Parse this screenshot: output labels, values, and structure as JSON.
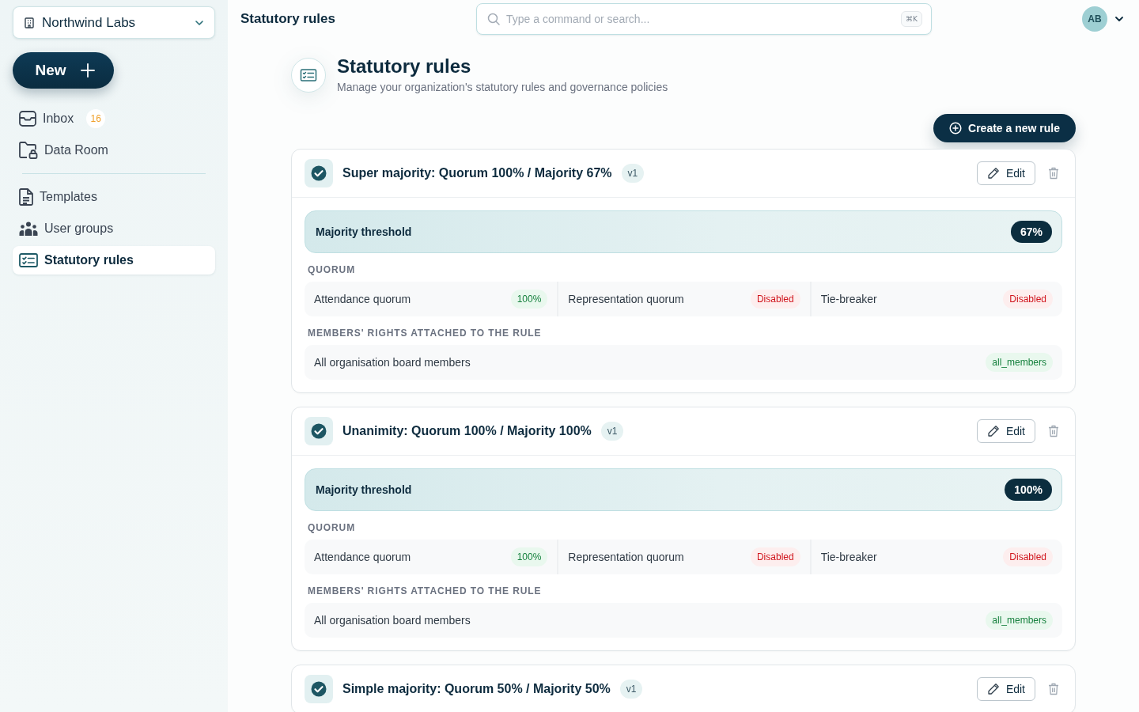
{
  "sidebar": {
    "organization": "Northwind Labs",
    "new_button": "New",
    "nav_groups": [
      {
        "items": [
          {
            "label": "Inbox",
            "badge": "16",
            "selected": false
          },
          {
            "label": "Data Room",
            "selected": false
          }
        ]
      },
      {
        "items": [
          {
            "label": "Templates",
            "selected": false
          },
          {
            "label": "User groups",
            "selected": false
          },
          {
            "label": "Statutory rules",
            "selected": true
          }
        ]
      }
    ]
  },
  "topbar": {
    "title": "Statutory rules",
    "search": {
      "placeholder": "Type a command or search...",
      "shortcut": "⌘K"
    },
    "avatar": "AB"
  },
  "page_header": {
    "title": "Statutory rules",
    "subtitle": "Manage your organization's statutory rules and governance policies"
  },
  "create_button": "Create a new rule",
  "rules": [
    {
      "title": "Super majority: Quorum 100% / Majority 67%",
      "version": "v1",
      "edit": "Edit",
      "threshold": {
        "label": "Majority threshold",
        "value": "67%"
      },
      "quorum_heading": "QUORUM",
      "quorum": [
        {
          "label": "Attendance quorum",
          "value": "100%",
          "enabled": true
        },
        {
          "label": "Representation quorum",
          "value": "Disabled",
          "enabled": false
        },
        {
          "label": "Tie-breaker",
          "value": "Disabled",
          "enabled": false
        }
      ],
      "members_heading": "MEMBERS' RIGHTS ATTACHED TO THE RULE",
      "members": {
        "label": "All organisation board members",
        "tag": "all_members"
      }
    },
    {
      "title": "Unanimity: Quorum 100% / Majority 100%",
      "version": "v1",
      "edit": "Edit",
      "threshold": {
        "label": "Majority threshold",
        "value": "100%"
      },
      "quorum_heading": "QUORUM",
      "quorum": [
        {
          "label": "Attendance quorum",
          "value": "100%",
          "enabled": true
        },
        {
          "label": "Representation quorum",
          "value": "Disabled",
          "enabled": false
        },
        {
          "label": "Tie-breaker",
          "value": "Disabled",
          "enabled": false
        }
      ],
      "members_heading": "MEMBERS' RIGHTS ATTACHED TO THE RULE",
      "members": {
        "label": "All organisation board members",
        "tag": "all_members"
      }
    },
    {
      "title": "Simple majority: Quorum 50% / Majority 50%",
      "version": "v1",
      "edit": "Edit"
    }
  ]
}
